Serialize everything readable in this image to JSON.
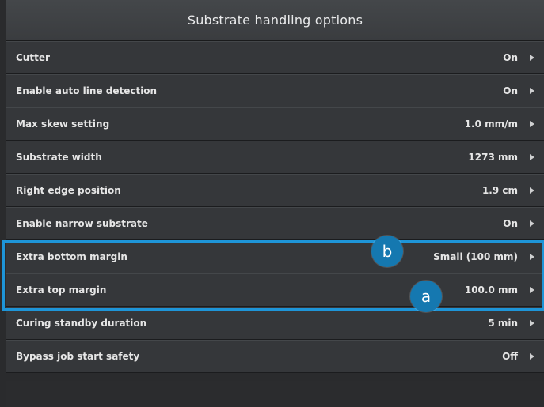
{
  "window": {
    "title": "Substrate handling options"
  },
  "rows": [
    {
      "label": "Cutter",
      "value": "On"
    },
    {
      "label": "Enable auto line detection",
      "value": "On"
    },
    {
      "label": "Max skew setting",
      "value": "1.0 mm/m"
    },
    {
      "label": "Substrate width",
      "value": "1273 mm"
    },
    {
      "label": "Right edge position",
      "value": "1.9 cm"
    },
    {
      "label": "Enable narrow substrate",
      "value": "On"
    },
    {
      "label": "Extra bottom margin",
      "value": "Small (100 mm)"
    },
    {
      "label": "Extra top margin",
      "value": "100.0 mm"
    },
    {
      "label": "Curing standby duration",
      "value": "5 min"
    },
    {
      "label": "Bypass job start safety",
      "value": "Off"
    }
  ],
  "annotations": {
    "b": "b",
    "a": "a"
  },
  "colors": {
    "highlight": "#1e95d8",
    "callout": "#1578b0"
  },
  "icons": {
    "row_chevron": "chevron-right-icon"
  }
}
